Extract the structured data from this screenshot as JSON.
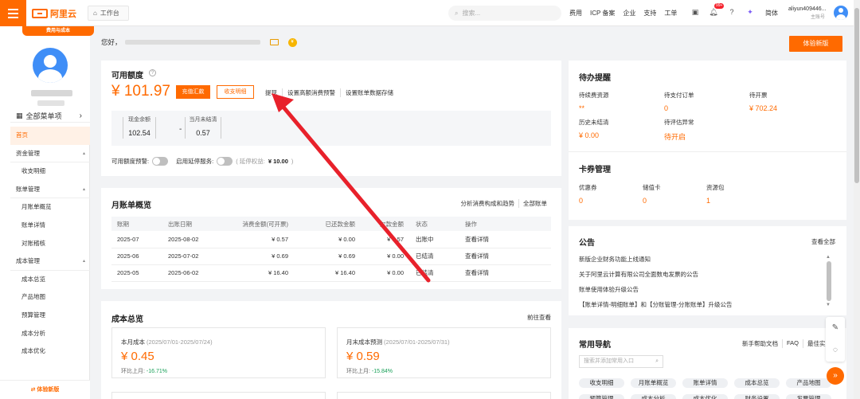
{
  "header": {
    "logo": "阿里云",
    "workbench": "工作台",
    "search_placeholder": "搜索...",
    "nav": [
      "费用",
      "ICP 备案",
      "企业",
      "支持",
      "工单"
    ],
    "notif_badge": "99+",
    "lang": "简体",
    "account_name": "aliyun409446...",
    "account_sub": "主账号"
  },
  "sidebar": {
    "tag": "费用与成本",
    "all_menu": "全部菜单项",
    "items": [
      {
        "label": "首页",
        "type": "active"
      },
      {
        "label": "资金管理",
        "type": "group"
      },
      {
        "label": "收支明细",
        "type": "sub"
      },
      {
        "label": "账单管理",
        "type": "group"
      },
      {
        "label": "月账单概览",
        "type": "sub"
      },
      {
        "label": "账单详情",
        "type": "sub"
      },
      {
        "label": "对账稽核",
        "type": "sub"
      },
      {
        "label": "成本管理",
        "type": "group"
      },
      {
        "label": "成本总览",
        "type": "sub"
      },
      {
        "label": "产品地图",
        "type": "sub"
      },
      {
        "label": "预算管理",
        "type": "sub"
      },
      {
        "label": "成本分析",
        "type": "sub"
      },
      {
        "label": "成本优化",
        "type": "sub"
      }
    ],
    "footer": "体验新版"
  },
  "greeting": "您好，",
  "try_new": "体验新版",
  "quota": {
    "title": "可用额度",
    "amount": "¥ 101.97",
    "recharge": "充值汇款",
    "details": "收支明细",
    "links": [
      "提现",
      "设置高额消费预警",
      "设置账单数据存储"
    ],
    "cash_label": "现金余额",
    "cash_value": "102.54",
    "minus": "-",
    "unsettled_label": "当月未结清",
    "unsettled_value": "0.57",
    "alert_label": "可用额度预警:",
    "delay_label": "启用延停服务:",
    "delay_rights": "( 延停权益:",
    "delay_value": "¥ 10.00",
    "delay_close": ")"
  },
  "monthly": {
    "title": "月账单概览",
    "link1": "分析消费构成和趋势",
    "link2": "全部账单",
    "columns": [
      "账期",
      "出账日期",
      "消费金额(可开票)",
      "已还款金额",
      "欠款金额",
      "状态",
      "操作"
    ],
    "rows": [
      {
        "period": "2025-07",
        "date": "2025-08-02",
        "amount": "¥ 0.57",
        "paid": "¥ 0.00",
        "owed": "¥ 0.57",
        "status": "出账中",
        "action": "查看详情"
      },
      {
        "period": "2025-06",
        "date": "2025-07-02",
        "amount": "¥ 0.69",
        "paid": "¥ 0.69",
        "owed": "¥ 0.00",
        "status": "已结清",
        "action": "查看详情"
      },
      {
        "period": "2025-05",
        "date": "2025-06-02",
        "amount": "¥ 16.40",
        "paid": "¥ 16.40",
        "owed": "¥ 0.00",
        "status": "已结清",
        "action": "查看详情"
      }
    ]
  },
  "cost": {
    "title": "成本总览",
    "more": "前往查看",
    "month_label": "本月成本",
    "month_range": "(2025/07/01-2025/07/24)",
    "month_value": "¥ 0.45",
    "month_cmp_label": "环比上月:",
    "month_cmp": "-16.71%",
    "forecast_label": "月末成本预测",
    "forecast_range": "(2025/07/01-2025/07/31)",
    "forecast_value": "¥ 0.59",
    "forecast_cmp_label": "环比上月:",
    "forecast_cmp": "-15.84%"
  },
  "todo": {
    "title": "待办提醒",
    "items": [
      {
        "label": "待续费资源",
        "value": "**"
      },
      {
        "label": "待支付订单",
        "value": "0"
      },
      {
        "label": "待开票",
        "value": "¥ 702.24"
      },
      {
        "label": "历史未结清",
        "value": "¥ 0.00"
      },
      {
        "label": "待评估异常",
        "value": "待开启"
      }
    ],
    "voucher_title": "卡券管理",
    "vouchers": [
      {
        "label": "优惠券",
        "value": "0"
      },
      {
        "label": "储值卡",
        "value": "0"
      },
      {
        "label": "资源包",
        "value": "1"
      }
    ]
  },
  "notice": {
    "title": "公告",
    "view_all": "查看全部",
    "items": [
      "新版企业财务功能上线通知",
      "关于阿里云计算有限公司全面数电发票的公告",
      "账单使用体验升级公告",
      "【账单详情-明细账单】和【分账管理-分账账单】升级公告"
    ]
  },
  "quicknav": {
    "title": "常用导航",
    "links": [
      "新手帮助文档",
      "FAQ",
      "最佳实践"
    ],
    "search_placeholder": "搜索并添加常用入口",
    "chips": [
      "收支明细",
      "月账单概览",
      "账单详情",
      "成本总览",
      "产品地图",
      "预算管理",
      "成本分析",
      "成本优化",
      "财务设置",
      "发票管理"
    ]
  },
  "colors": {
    "accent": "#ff6a00",
    "link": "#0070cc",
    "annotation_arrow": "#e8212b"
  }
}
